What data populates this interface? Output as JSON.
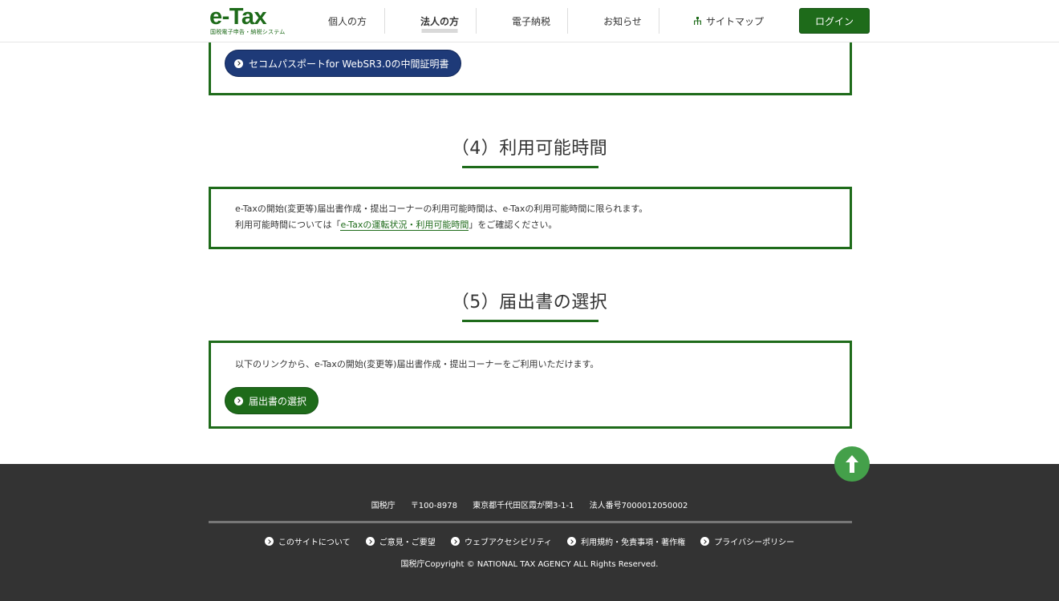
{
  "header": {
    "logo": "e-Tax",
    "logo_sub": "国税電子申告・納税システム",
    "nav": [
      {
        "label": "個人の方"
      },
      {
        "label": "法人の方"
      },
      {
        "label": "電子納税"
      },
      {
        "label": "お知らせ"
      },
      {
        "label": "サイトマップ"
      }
    ],
    "login": "ログイン"
  },
  "section3": {
    "cert_button": "セコムパスポートfor WebSR3.0の中間証明書"
  },
  "section4": {
    "title": "（4）利用可能時間",
    "line1": "e-Taxの開始(変更等)届出書作成・提出コーナーの利用可能時間は、e-Taxの利用可能時間に限られます。",
    "line2_pre": "利用可能時間については「",
    "line2_link": "e-Taxの運転状況・利用可能時間",
    "line2_post": "」をご確認ください。"
  },
  "section5": {
    "title": "（5）届出書の選択",
    "text": "以下のリンクから、e-Taxの開始(変更等)届出書作成・提出コーナーをご利用いただけます。",
    "button": "届出書の選択"
  },
  "footer": {
    "agency": "国税庁",
    "postal": "〒100-8978",
    "address": "東京都千代田区霞が関3-1-1",
    "corp_no": "法人番号7000012050002",
    "links": [
      {
        "label": "このサイトについて"
      },
      {
        "label": "ご意見・ご要望"
      },
      {
        "label": "ウェブアクセシビリティ"
      },
      {
        "label": "利用規約・免責事項・著作権"
      },
      {
        "label": "プライバシーポリシー"
      }
    ],
    "copyright": "国税庁Copyright © NATIONAL TAX AGENCY ALL Rights Reserved."
  },
  "colors": {
    "brand_green": "#1e6b1a",
    "navy_button": "#1e3a78",
    "to_top": "#44a04a",
    "footer_bg": "#333333"
  }
}
